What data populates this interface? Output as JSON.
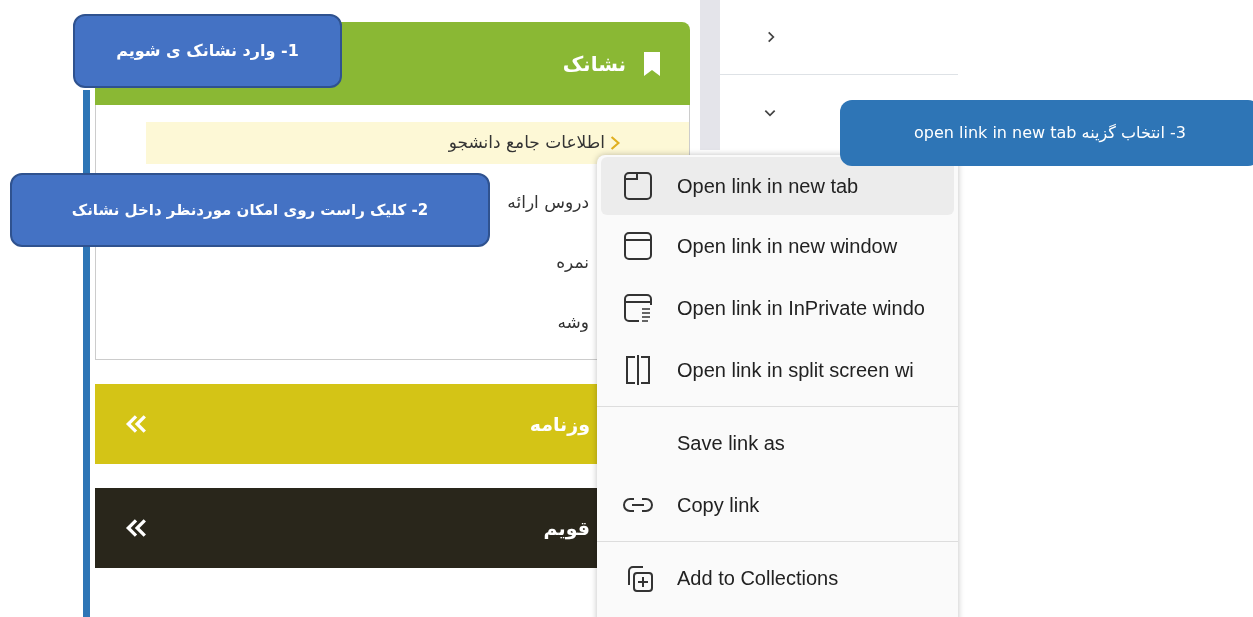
{
  "bookmark_panel": {
    "title": "نشانک",
    "items": [
      {
        "label": "اطلاعات جامع دانشجو",
        "selected": true
      },
      {
        "label": "دروس ارائه",
        "selected": false
      },
      {
        "label": "نمره",
        "selected": false
      },
      {
        "label": "وشه",
        "selected": false
      }
    ]
  },
  "collapsed_panels": [
    {
      "title": "وزنامه",
      "color": "#d4c416"
    },
    {
      "title": "قويم",
      "color": "#29261b"
    }
  ],
  "context_menu": {
    "items": [
      {
        "kind": "item",
        "label": "Open link in new tab",
        "selected": true
      },
      {
        "kind": "item",
        "label": "Open link in new window",
        "selected": false
      },
      {
        "kind": "item",
        "label": "Open link in InPrivate windo",
        "selected": false
      },
      {
        "kind": "item",
        "label": "Open link in split screen wi",
        "selected": false
      },
      {
        "kind": "divider"
      },
      {
        "kind": "item",
        "label": "Save link as",
        "selected": false
      },
      {
        "kind": "item",
        "label": "Copy link",
        "selected": false
      },
      {
        "kind": "divider"
      },
      {
        "kind": "item",
        "label": "Add to Collections",
        "selected": false
      }
    ]
  },
  "callouts": [
    {
      "text": "1- وارد نشانک ی شویم"
    },
    {
      "text": "2- کلیک راست روی امکان موردنظر داخل نشانک"
    },
    {
      "text": "3- انتخاب گزینه open link in new tab"
    }
  ]
}
